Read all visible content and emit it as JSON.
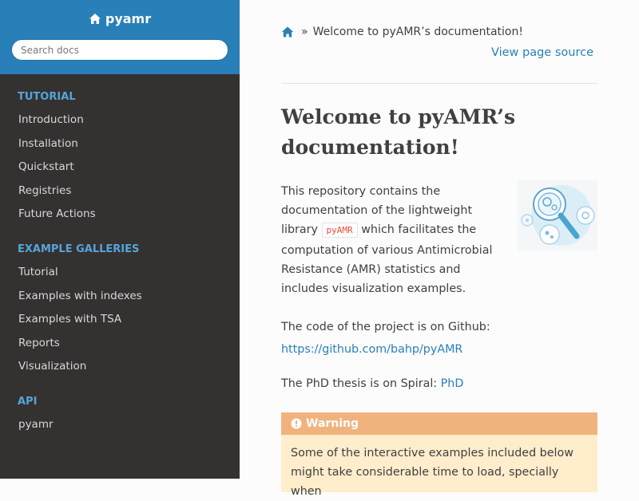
{
  "sidebar": {
    "brand": "pyamr",
    "search_placeholder": "Search docs",
    "sections": [
      {
        "caption": "TUTORIAL",
        "items": [
          "Introduction",
          "Installation",
          "Quickstart",
          "Registries",
          "Future Actions"
        ]
      },
      {
        "caption": "EXAMPLE GALLERIES",
        "items": [
          "Tutorial",
          "Examples with indexes",
          "Examples with TSA",
          "Reports",
          "Visualization"
        ]
      },
      {
        "caption": "API",
        "items": [
          "pyamr"
        ]
      }
    ]
  },
  "breadcrumbs": {
    "separator": "»",
    "current": "Welcome to pyAMR’s documentation!"
  },
  "view_source": "View page source",
  "page": {
    "title": "Welcome to pyAMR’s documentation!",
    "intro_before": "This repository contains the documentation of the lightweight library",
    "intro_code": "pyAMR",
    "intro_after": "which facilitates the computation of various Antimicrobial Resistance (AMR) statistics and includes visualization examples.",
    "github_text": "The code of the project is on Github:",
    "github_link": "https://github.com/bahp/pyAMR",
    "phd_text": "The PhD thesis is on Spiral:",
    "phd_link": "PhD",
    "warning_title": "Warning",
    "warning_body": "Some of the interactive examples included below might take considerable time to load, specially when"
  },
  "colors": {
    "sidebar_bg": "#343131",
    "sidebar_top": "#2980b9",
    "caption": "#55a5d9",
    "link": "#2980b9",
    "warning_title_bg": "#f0b37e",
    "warning_bg": "#ffedcc"
  },
  "icons": {
    "brand": "home-icon",
    "breadcrumb_home": "home-icon",
    "warning": "exclamation-circle-icon"
  }
}
